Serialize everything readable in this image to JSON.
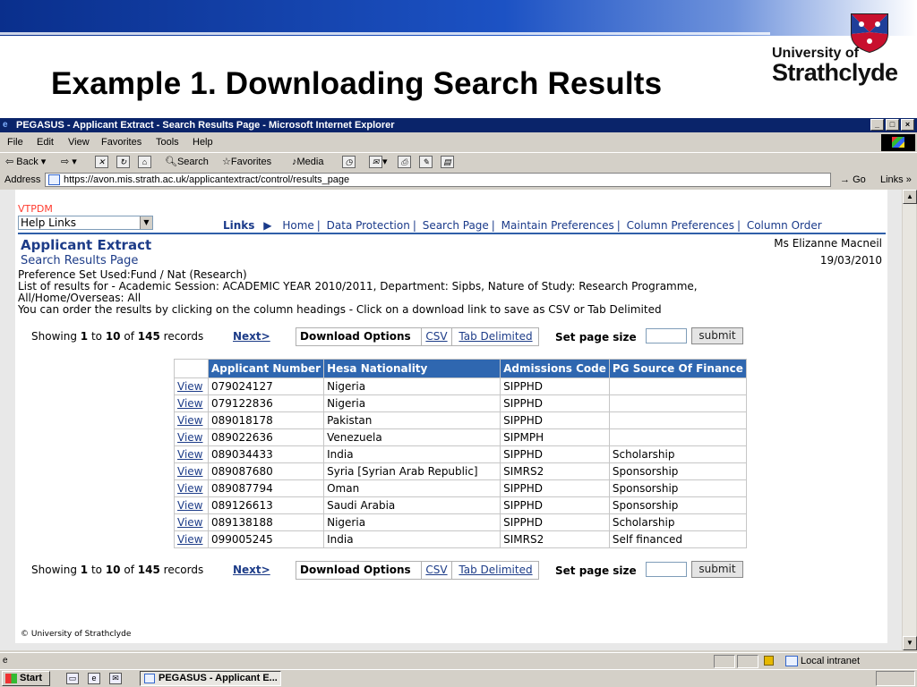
{
  "slide": {
    "title": "Example 1. Downloading Search Results",
    "logo_small": "University of",
    "logo_big": "Strathclyde"
  },
  "window": {
    "title": "PEGASUS - Applicant Extract - Search Results Page - Microsoft Internet Explorer",
    "controls": [
      "_",
      "□",
      "×"
    ]
  },
  "menu": [
    "File",
    "Edit",
    "View",
    "Favorites",
    "Tools",
    "Help"
  ],
  "toolbar": {
    "back": "Back",
    "search": "Search",
    "favorites": "Favorites",
    "media": "Media"
  },
  "address": {
    "label": "Address",
    "url": "https://avon.mis.strath.ac.uk/applicantextract/control/results_page",
    "go": "Go",
    "links": "Links"
  },
  "page": {
    "system": "VTPDM",
    "help_select": "Help Links",
    "nav_label": "Links",
    "nav_links": [
      "Home",
      "Data Protection",
      "Search Page",
      "Maintain Preferences",
      "Column Preferences",
      "Column Order"
    ],
    "app_title": "Applicant Extract",
    "user": "Ms Elizanne Macneil",
    "subtitle": "Search Results Page",
    "date": "19/03/2010",
    "info_lines": [
      "Preference Set Used:Fund / Nat (Research)",
      "List of results for - Academic Session: ACADEMIC YEAR 2010/2011, Department: Sipbs, Nature of Study: Research Programme,",
      "All/Home/Overseas: All",
      "You can order the results by clicking on the column headings - Click on a download link to save as CSV or Tab Delimited"
    ],
    "results": {
      "showing": "Showing",
      "from": "1",
      "to_word": "to",
      "to": "10",
      "of_word": "of",
      "total": "145",
      "records": "records",
      "next": "Next>",
      "download_label": "Download Options",
      "csv": "CSV",
      "tab": "Tab Delimited",
      "page_size_label": "Set page size",
      "submit": "submit"
    },
    "table": {
      "headers": [
        "Applicant Number",
        "Hesa Nationality",
        "Admissions Code",
        "PG Source Of Finance"
      ],
      "view_label": "View",
      "rows": [
        [
          "079024127",
          "Nigeria",
          "SIPPHD",
          ""
        ],
        [
          "079122836",
          "Nigeria",
          "SIPPHD",
          ""
        ],
        [
          "089018178",
          "Pakistan",
          "SIPPHD",
          ""
        ],
        [
          "089022636",
          "Venezuela",
          "SIPMPH",
          ""
        ],
        [
          "089034433",
          "India",
          "SIPPHD",
          "Scholarship"
        ],
        [
          "089087680",
          "Syria [Syrian Arab Republic]",
          "SIMRS2",
          "Sponsorship"
        ],
        [
          "089087794",
          "Oman",
          "SIPPHD",
          "Sponsorship"
        ],
        [
          "089126613",
          "Saudi Arabia",
          "SIPPHD",
          "Sponsorship"
        ],
        [
          "089138188",
          "Nigeria",
          "SIPPHD",
          "Scholarship"
        ],
        [
          "099005245",
          "India",
          "SIMRS2",
          "Self financed"
        ]
      ]
    },
    "copyright": "© University of Strathclyde"
  },
  "status": {
    "zone": "Local intranet"
  },
  "taskbar": {
    "start": "Start",
    "task": "PEGASUS - Applicant E..."
  },
  "colors": {
    "arrow": "#0070c0",
    "header_bg": "#2f67b0",
    "link": "#1d3c88"
  }
}
